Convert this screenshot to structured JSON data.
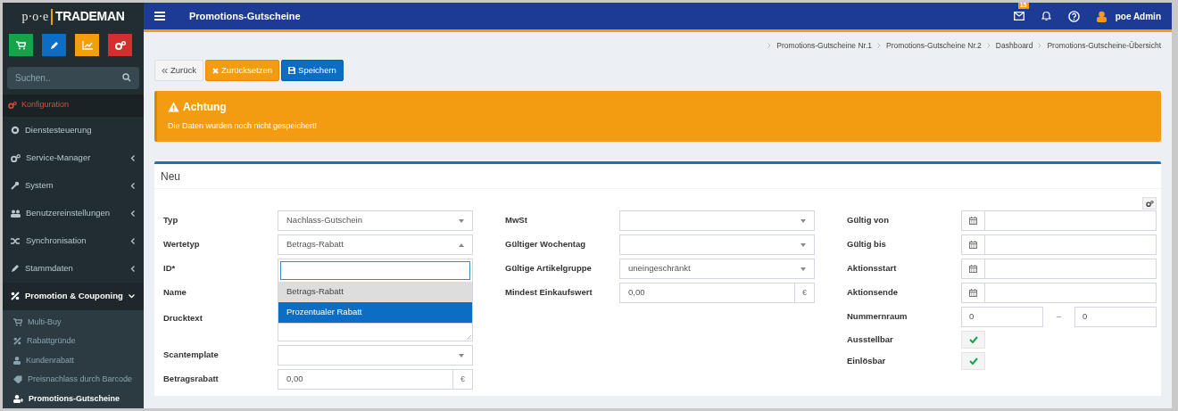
{
  "app": {
    "logo_prefix": "p·o·e",
    "logo_name": "TRADEMAN",
    "search": {
      "placeholder": "Suchen.."
    }
  },
  "sidebar": {
    "section": "Konfiguration",
    "items": [
      {
        "label": "Dienstesteuerung",
        "has_children": false,
        "expanded": false
      },
      {
        "label": "Service-Manager",
        "has_children": true,
        "expanded": false
      },
      {
        "label": "System",
        "has_children": true,
        "expanded": false
      },
      {
        "label": "Benutzereinstellungen",
        "has_children": true,
        "expanded": false
      },
      {
        "label": "Synchronisation",
        "has_children": true,
        "expanded": false
      },
      {
        "label": "Stammdaten",
        "has_children": true,
        "expanded": false
      },
      {
        "label": "Promotion & Couponing",
        "has_children": true,
        "expanded": true,
        "children": [
          {
            "label": "Multi-Buy",
            "selected": false
          },
          {
            "label": "Rabattgründe",
            "selected": false
          },
          {
            "label": "Kundenrabatt",
            "selected": false
          },
          {
            "label": "Preisnachlass durch Barcode",
            "selected": false
          },
          {
            "label": "Promotions-Gutscheine",
            "selected": true
          }
        ]
      }
    ]
  },
  "topbar": {
    "title": "Promotions-Gutscheine",
    "mail_badge": "15",
    "user": "poe Admin"
  },
  "breadcrumbs": [
    "Promotions-Gutscheine Nr.1",
    "Promotions-Gutscheine Nr.2",
    "Dashboard",
    "Promotions-Gutscheine-Übersicht"
  ],
  "actions": [
    {
      "label": "Zurück",
      "kind": "back"
    },
    {
      "label": "Zurücksetzen",
      "kind": "reset"
    },
    {
      "label": "Speichern",
      "kind": "save"
    }
  ],
  "alert": {
    "title": "Achtung",
    "message": "Die Daten wurden noch nicht gespeichert!"
  },
  "form": {
    "title": "Neu",
    "columns": [
      [
        {
          "label": "Typ",
          "kind": "select",
          "value": "Nachlass-Gutschein"
        },
        {
          "label": "Wertetyp",
          "kind": "select",
          "value": "Betrags-Rabatt",
          "expanded": true,
          "options": [
            {
              "label": "Betrags-Rabatt",
              "selected": true,
              "highlighted": false
            },
            {
              "label": "Prozentualer Rabatt",
              "selected": false,
              "highlighted": true
            }
          ]
        },
        {
          "label": "ID*",
          "kind": "covered"
        },
        {
          "label": "Name",
          "kind": "covered"
        },
        {
          "label": "Drucktext",
          "kind": "textarea"
        },
        {
          "label": "Scantemplate",
          "kind": "select"
        },
        {
          "label": "Betragsrabatt",
          "kind": "money",
          "value": "0,00",
          "unit": "€"
        }
      ],
      [
        {
          "label": "MwSt",
          "kind": "select"
        },
        {
          "label": "Gültiger Wochentag",
          "kind": "select"
        },
        {
          "label": "Gültige Artikelgruppe",
          "kind": "select",
          "value": "uneingeschränkt"
        },
        {
          "label": "Mindest Einkaufswert",
          "kind": "money",
          "value": "0,00",
          "unit": "€"
        }
      ],
      [
        {
          "label": "Gültig von",
          "kind": "date"
        },
        {
          "label": "Gültig bis",
          "kind": "date"
        },
        {
          "label": "Aktionsstart",
          "kind": "date"
        },
        {
          "label": "Aktionsende",
          "kind": "date"
        },
        {
          "label": "Nummernraum",
          "kind": "range",
          "from": "0",
          "separator": "–",
          "to": "0"
        },
        {
          "label": "Ausstellbar",
          "kind": "check",
          "checked": true
        },
        {
          "label": "Einlösbar",
          "kind": "check",
          "checked": true
        }
      ]
    ]
  }
}
